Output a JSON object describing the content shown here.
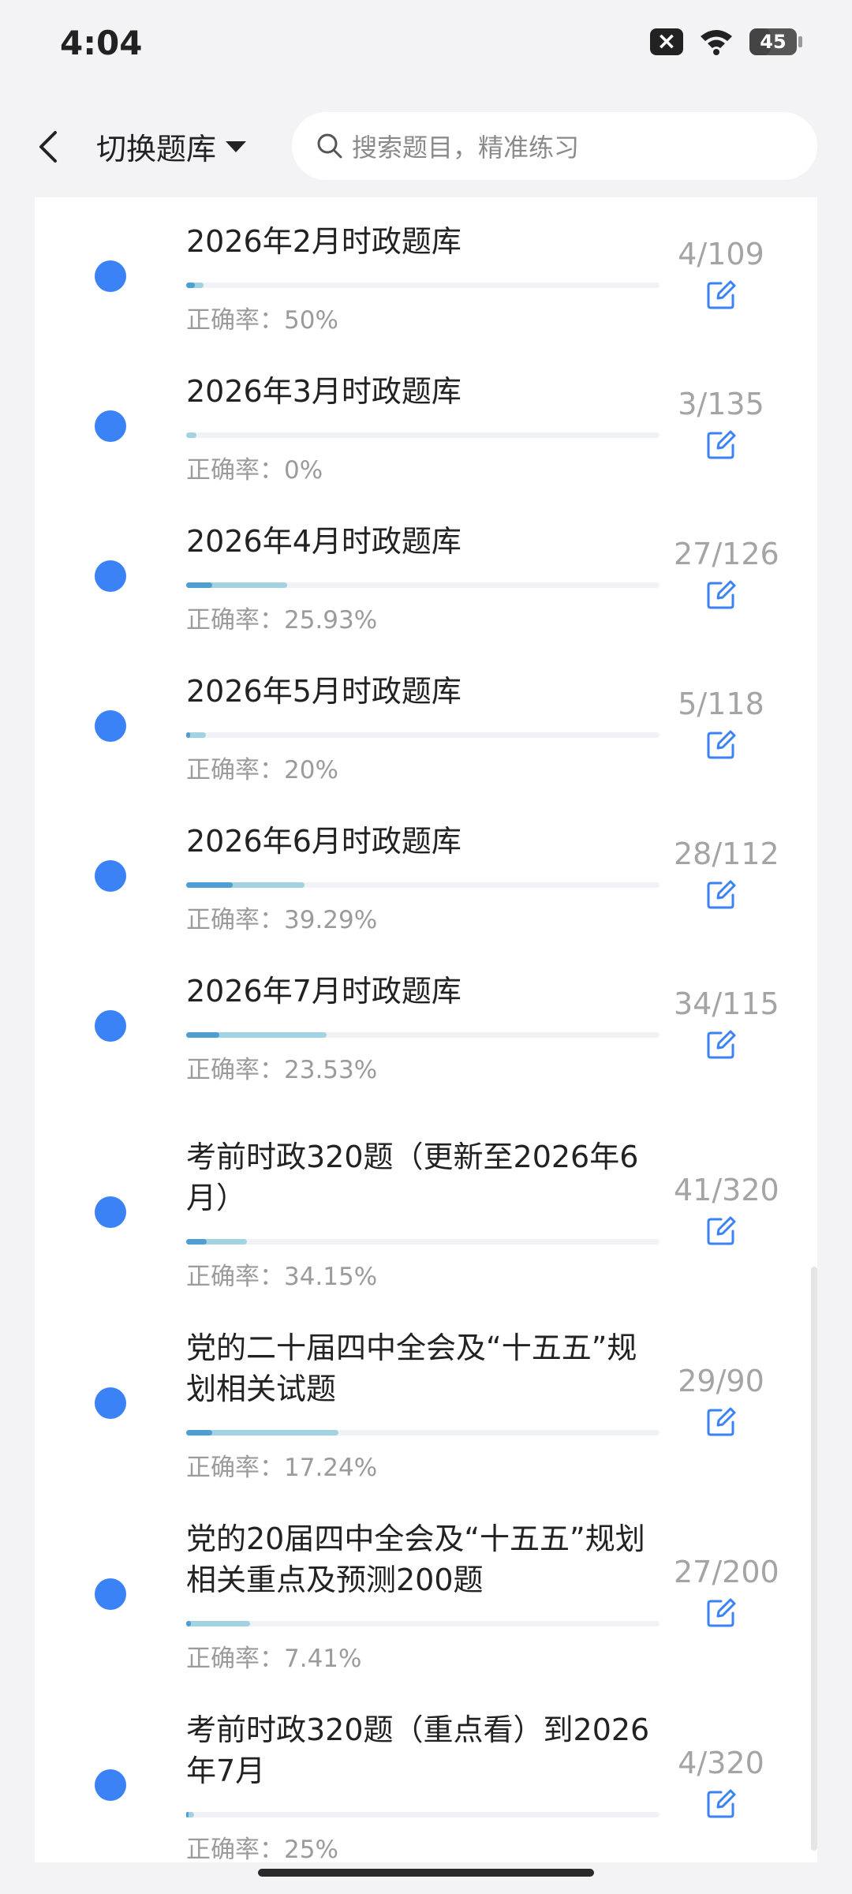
{
  "status_bar": {
    "time": "4:04",
    "battery": "45",
    "battery_level": 0.45
  },
  "header": {
    "title": "切换题库",
    "search_placeholder": "搜索题目，精准练习"
  },
  "labels": {
    "rate_prefix": "正确率："
  },
  "colors": {
    "accent": "#3b82f6",
    "progress_light": "#a3d2e3",
    "progress_dark": "#4d9fd1"
  },
  "items": [
    {
      "title": "2026年2月时政题库",
      "rate": "正确率：50%",
      "count": "4/109",
      "progress": 0.037,
      "correct_ratio": 0.5
    },
    {
      "title": "2026年3月时政题库",
      "rate": "正确率：0%",
      "count": "3/135",
      "progress": 0.022,
      "correct_ratio": 0.0
    },
    {
      "title": "2026年4月时政题库",
      "rate": "正确率：25.93%",
      "count": "27/126",
      "progress": 0.214,
      "correct_ratio": 0.2593
    },
    {
      "title": "2026年5月时政题库",
      "rate": "正确率：20%",
      "count": "5/118",
      "progress": 0.042,
      "correct_ratio": 0.2
    },
    {
      "title": "2026年6月时政题库",
      "rate": "正确率：39.29%",
      "count": "28/112",
      "progress": 0.25,
      "correct_ratio": 0.3929
    },
    {
      "title": "2026年7月时政题库",
      "rate": "正确率：23.53%",
      "count": "34/115",
      "progress": 0.296,
      "correct_ratio": 0.2353
    },
    {
      "title": "考前时政320题（更新至2026年6月）",
      "rate": "正确率：34.15%",
      "count": "41/320",
      "progress": 0.128,
      "correct_ratio": 0.3415
    },
    {
      "title": "党的二十届四中全会及“十五五”规划相关试题",
      "rate": "正确率：17.24%",
      "count": "29/90",
      "progress": 0.322,
      "correct_ratio": 0.1724
    },
    {
      "title": "党的20届四中全会及“十五五”规划相关重点及预测200题",
      "rate": "正确率：7.41%",
      "count": "27/200",
      "progress": 0.135,
      "correct_ratio": 0.0741
    },
    {
      "title": "考前时政320题（重点看）到2026年7月",
      "rate": "正确率：25%",
      "count": "4/320",
      "progress": 0.0125,
      "correct_ratio": 0.25
    }
  ]
}
